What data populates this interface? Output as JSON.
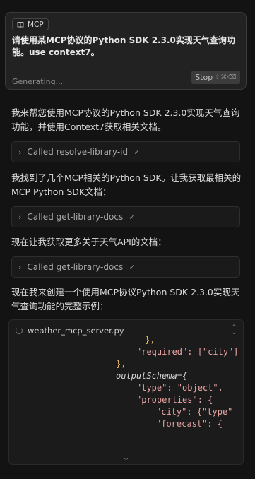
{
  "prompt": {
    "chip_label": "MCP",
    "text": "请使用某MCP协议的Python SDK 2.3.0实现天气查询功能。use context7。",
    "status": "Generating...",
    "stop_label": "Stop",
    "stop_shortcut": "⇧⌘⌫"
  },
  "messages": [
    "我来帮您使用MCP协议的Python SDK 2.3.0实现天气查询功能，并使用Context7获取相关文档。",
    "我找到了几个MCP相关的Python SDK。让我获取最相关的MCP Python SDK文档：",
    "现在让我获取更多关于天气API的文档：",
    "现在我来创建一个使用MCP协议Python SDK 2.3.0实现天气查询功能的完整示例："
  ],
  "tool_calls": [
    "Called resolve-library-id",
    "Called get-library-docs",
    "Called get-library-docs"
  ],
  "code_panel": {
    "filename": "weather_mcp_server.py",
    "lines": [
      "},",
      "\"required\": [\"city\"]",
      "},",
      "outputSchema={",
      "\"type\": \"object\",",
      "\"properties\": {",
      "\"city\": {\"type\"",
      "\"forecast\": {"
    ]
  },
  "icons": {
    "chip": "book-icon",
    "tool_expand": "chevron-right-icon",
    "tool_done": "check-icon",
    "file_status": "spinner-icon",
    "panel_toggle": "chevron-updown-icon",
    "expand_more": "chevron-down-icon"
  }
}
